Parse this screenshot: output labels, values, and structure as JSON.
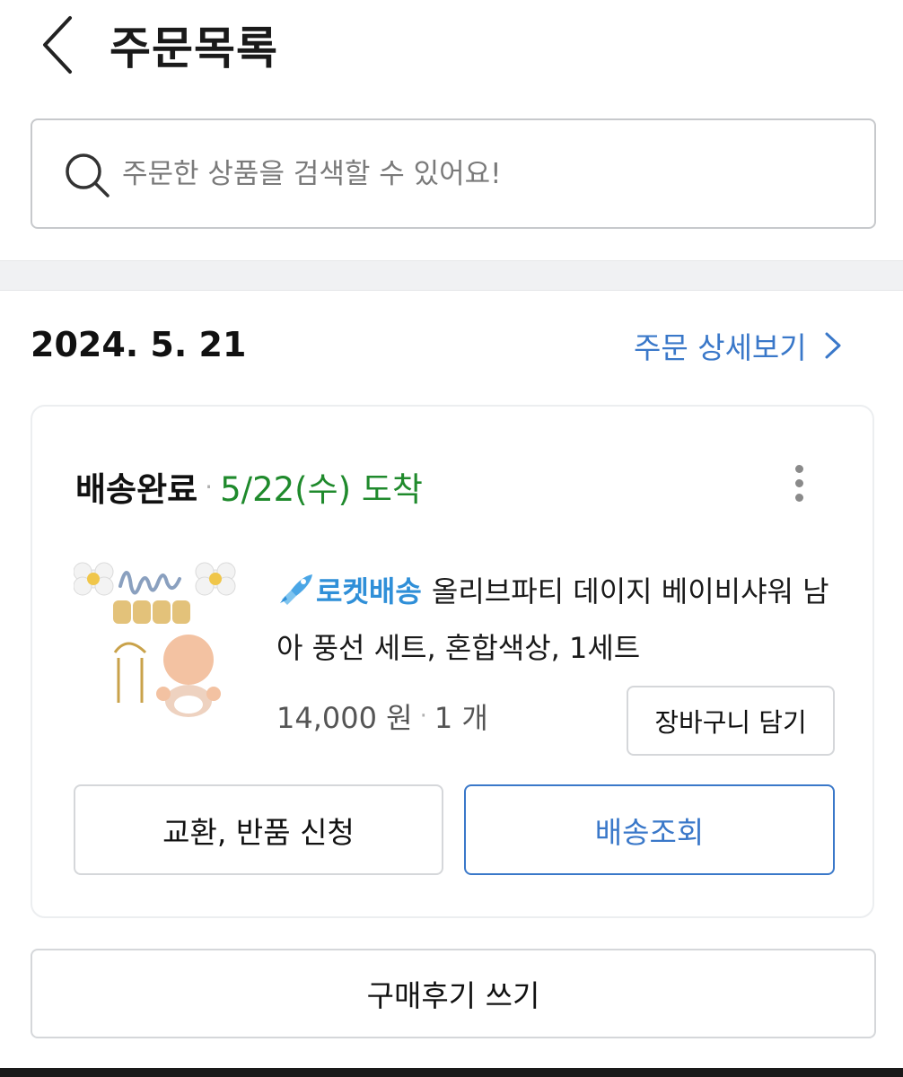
{
  "header": {
    "title": "주문목록",
    "back_icon": "chevron-left-icon"
  },
  "search": {
    "placeholder": "주문한 상품을 검색할 수 있어요!",
    "icon": "search-icon"
  },
  "order": {
    "date": "2024. 5. 21",
    "detail_link": "주문 상세보기",
    "status": "배송완료",
    "arrival": "5/22(수) 도착",
    "product": {
      "badge": "로켓배송",
      "name": "올리브파티 데이지 베이비샤워 남아 풍선 세트, 혼합색상, 1세트",
      "price": "14,000 원",
      "quantity": "1 개",
      "thumbnail": "hello-baby-balloon-set-image"
    },
    "cart_button": "장바구니 담기",
    "exchange_button": "교환, 반품 신청",
    "tracking_button": "배송조회"
  },
  "review_button": "구매후기 쓰기",
  "colors": {
    "accent": "#3a78c9",
    "arrival_green": "#1f8a2c",
    "rocket_blue": "#2f8fd8"
  }
}
